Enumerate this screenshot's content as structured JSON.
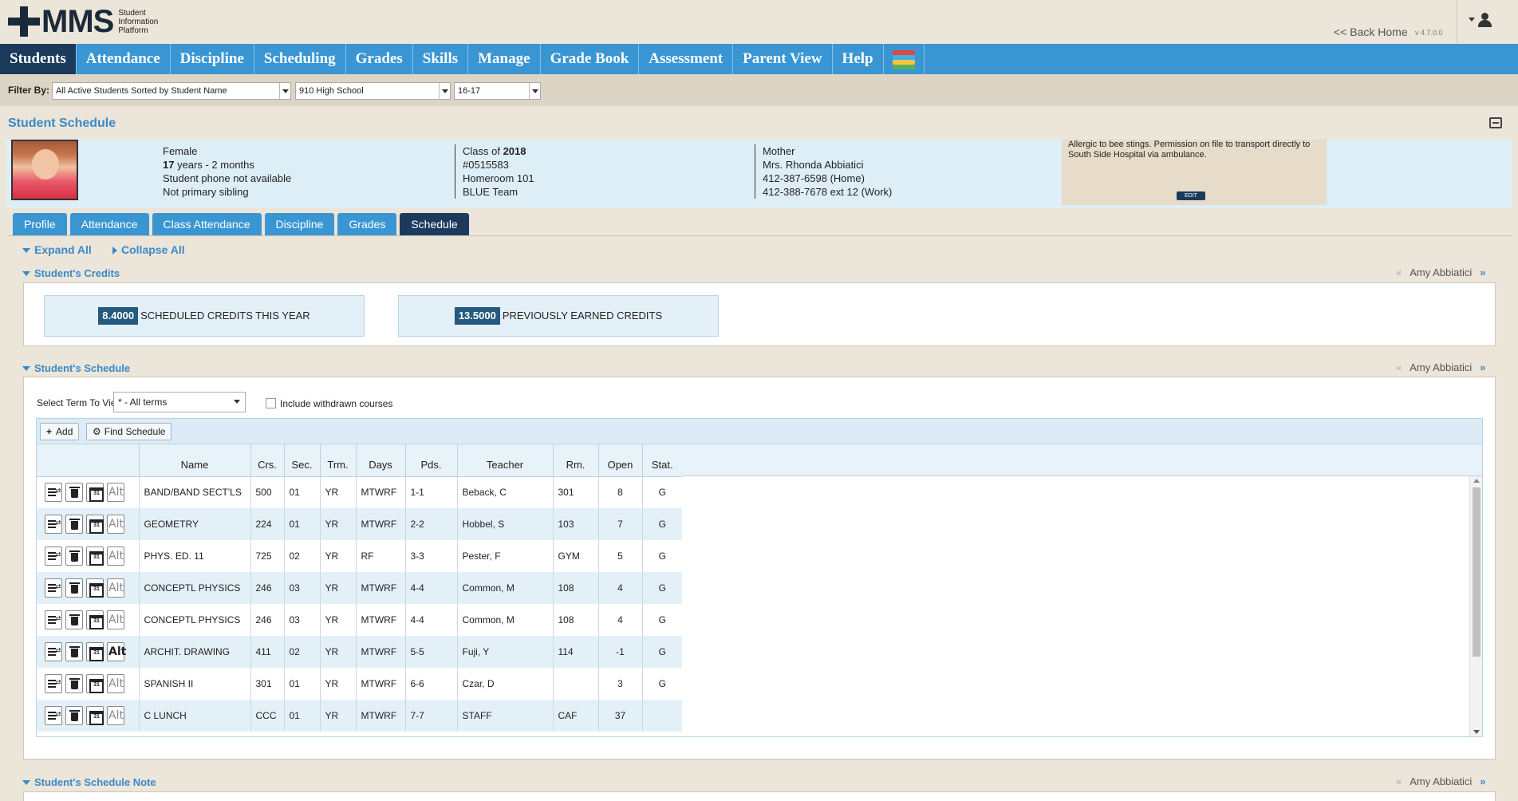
{
  "app": {
    "logo_text": "MMS",
    "logo_sub": [
      "Student",
      "Information",
      "Platform"
    ],
    "back_home": "<< Back Home",
    "version": "v 4.7.0.0"
  },
  "nav": {
    "items": [
      "Students",
      "Attendance",
      "Discipline",
      "Scheduling",
      "Grades",
      "Skills",
      "Manage",
      "Grade Book",
      "Assessment",
      "Parent View",
      "Help"
    ],
    "active": "Students"
  },
  "filter": {
    "label": "Filter By:",
    "students": "All Active Students Sorted by Student Name",
    "school": "910 High School",
    "year": "16-17"
  },
  "page": {
    "title": "Student Schedule"
  },
  "student": {
    "col1": [
      "Female",
      "17 years - 2 months",
      "Student phone not available",
      "Not primary sibling"
    ],
    "age_years": "17",
    "age_rest": " years - 2 months",
    "class_of_label": "Class of ",
    "class_of_year": "2018",
    "col2": [
      "#0515583",
      "Homeroom 101",
      "BLUE Team"
    ],
    "col3": [
      "Mother",
      "Mrs. Rhonda Abbiatici",
      "412-387-6598 (Home)",
      "412-388-7678 ext 12 (Work)"
    ],
    "alert": "Allergic to bee stings. Permission on file to transport directly to South Side Hospital via ambulance.",
    "edit_label": "EDIT"
  },
  "subtabs": {
    "items": [
      "Profile",
      "Attendance",
      "Class Attendance",
      "Discipline",
      "Grades",
      "Schedule"
    ],
    "active": "Schedule"
  },
  "controls": {
    "expand_all": "Expand All",
    "collapse_all": "Collapse All"
  },
  "credits_section": {
    "title": "Student's Credits",
    "student_name": "Amy Abbiatici",
    "scheduled_value": "8.4000",
    "scheduled_label": "SCHEDULED CREDITS THIS YEAR",
    "earned_value": "13.5000",
    "earned_label": "PREVIOUSLY EARNED CREDITS"
  },
  "schedule_section": {
    "title": "Student's Schedule",
    "student_name": "Amy Abbiatici",
    "term_label": "Select Term To View:",
    "term_value": "* - All terms",
    "withdrawn_label": "Include withdrawn courses",
    "add_label": "Add",
    "find_label": "Find Schedule",
    "columns": [
      "Name",
      "Crs.",
      "Sec.",
      "Trm.",
      "Days",
      "Pds.",
      "Teacher",
      "Rm.",
      "Open",
      "Stat."
    ],
    "rows": [
      [
        "BAND/BAND SECT'LS",
        "500",
        "01",
        "YR",
        "MTWRF",
        "1-1",
        "Beback, C",
        "301",
        "8",
        "G"
      ],
      [
        "GEOMETRY",
        "224",
        "01",
        "YR",
        "MTWRF",
        "2-2",
        "Hobbel, S",
        "103",
        "7",
        "G"
      ],
      [
        "PHYS. ED. 11",
        "725",
        "02",
        "YR",
        "RF",
        "3-3",
        "Pester, F",
        "GYM",
        "5",
        "G"
      ],
      [
        "CONCEPTL PHYSICS",
        "246",
        "03",
        "YR",
        "MTWRF",
        "4-4",
        "Common, M",
        "108",
        "4",
        "G"
      ],
      [
        "CONCEPTL PHYSICS",
        "246",
        "03",
        "YR",
        "MTWRF",
        "4-4",
        "Common, M",
        "108",
        "4",
        "G"
      ],
      [
        "ARCHIT. DRAWING",
        "411",
        "02",
        "YR",
        "MTWRF",
        "5-5",
        "Fuji, Y",
        "114",
        "-1",
        "G"
      ],
      [
        "SPANISH II",
        "301",
        "01",
        "YR",
        "MTWRF",
        "6-6",
        "Czar, D",
        "",
        "3",
        "G"
      ],
      [
        "C LUNCH",
        "CCC",
        "01",
        "YR",
        "MTWRF",
        "7-7",
        "STAFF",
        "CAF",
        "37",
        ""
      ]
    ]
  },
  "note_section": {
    "title": "Student's Schedule Note",
    "student_name": "Amy Abbiatici"
  },
  "colors": {
    "nav": "#3a96d3",
    "nav_active": "#1c3b5c",
    "accent_text": "#3a8ac8",
    "row_alt": "#e4f0f8"
  }
}
